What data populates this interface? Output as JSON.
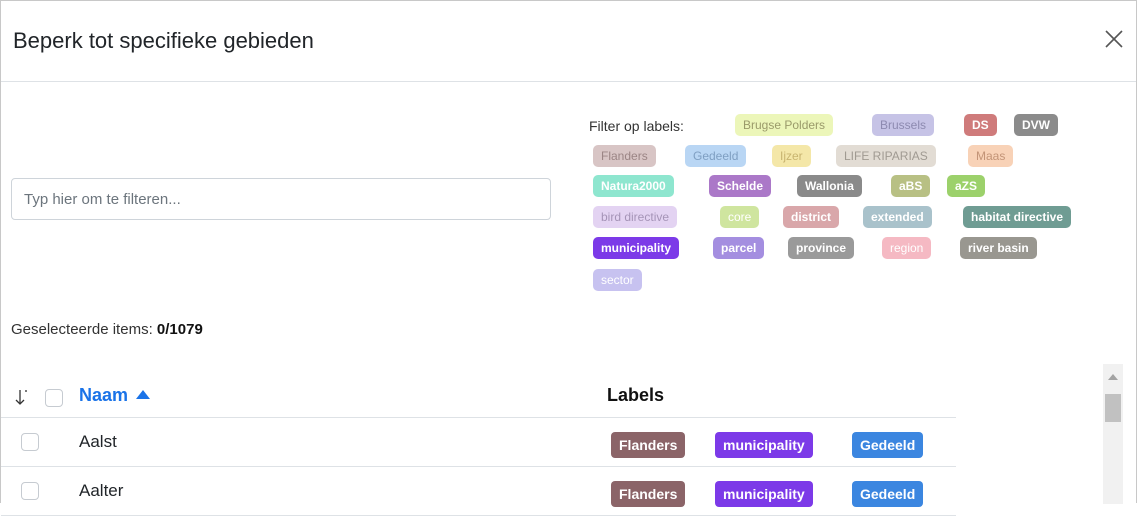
{
  "dialog": {
    "title": "Beperk tot specifieke gebieden"
  },
  "search": {
    "placeholder": "Typ hier om te filteren...",
    "value": ""
  },
  "filter": {
    "prefix": "Filter op labels:",
    "chips": [
      {
        "label": "Brugse Polders",
        "bg": "#ecf6b9",
        "fg": "#9a9a6a",
        "bold": false
      },
      {
        "label": "Brussels",
        "bg": "#c6c3e6",
        "fg": "#8d8ab0",
        "bold": false
      },
      {
        "label": "DS",
        "bg": "#cf7b7b",
        "fg": "#ffffff",
        "bold": true
      },
      {
        "label": "DVW",
        "bg": "#8b8b8b",
        "fg": "#ffffff",
        "bold": true
      },
      {
        "label": "Flanders",
        "bg": "#d8c5c5",
        "fg": "#9b8585",
        "bold": false
      },
      {
        "label": "Gedeeld",
        "bg": "#b9d6f4",
        "fg": "#7f9fc2",
        "bold": false
      },
      {
        "label": "Ijzer",
        "bg": "#f4e7a8",
        "fg": "#c8b470",
        "bold": false
      },
      {
        "label": "LIFE RIPARIAS",
        "bg": "#e2dcd4",
        "fg": "#a09a92",
        "bold": false
      },
      {
        "label": "Maas",
        "bg": "#f8d2b7",
        "fg": "#c39477",
        "bold": false
      },
      {
        "label": "Natura2000",
        "bg": "#8ee6cf",
        "fg": "#ffffff",
        "bold": true
      },
      {
        "label": "Schelde",
        "bg": "#ab78c8",
        "fg": "#ffffff",
        "bold": true
      },
      {
        "label": "Wallonia",
        "bg": "#8a8a8a",
        "fg": "#ffffff",
        "bold": true
      },
      {
        "label": "aBS",
        "bg": "#b8c084",
        "fg": "#ffffff",
        "bold": true
      },
      {
        "label": "aZS",
        "bg": "#9cd16b",
        "fg": "#ffffff",
        "bold": true
      },
      {
        "label": "bird directive",
        "bg": "#e3d3f2",
        "fg": "#a594b7",
        "bold": false
      },
      {
        "label": "core",
        "bg": "#cfe59f",
        "fg": "#ffffff",
        "bold": false
      },
      {
        "label": "district",
        "bg": "#d9a7aa",
        "fg": "#ffffff",
        "bold": true
      },
      {
        "label": "extended",
        "bg": "#a9c2cb",
        "fg": "#ffffff",
        "bold": true
      },
      {
        "label": "habitat directive",
        "bg": "#6f9c93",
        "fg": "#ffffff",
        "bold": true
      },
      {
        "label": "municipality",
        "bg": "#7c3ae8",
        "fg": "#ffffff",
        "bold": true
      },
      {
        "label": "parcel",
        "bg": "#a48ee0",
        "fg": "#ffffff",
        "bold": true
      },
      {
        "label": "province",
        "bg": "#9a9a9a",
        "fg": "#ffffff",
        "bold": true
      },
      {
        "label": "region",
        "bg": "#f5b9c3",
        "fg": "#ffffff",
        "bold": false
      },
      {
        "label": "river basin",
        "bg": "#999790",
        "fg": "#ffffff",
        "bold": true
      },
      {
        "label": "sector",
        "bg": "#c7c2f0",
        "fg": "#ffffff",
        "bold": false
      }
    ]
  },
  "selection": {
    "prefix": "Geselecteerde items: ",
    "count": "0/1079"
  },
  "table": {
    "columns": {
      "name": "Naam",
      "labels": "Labels"
    },
    "rows": [
      {
        "name": "Aalst",
        "tags": [
          {
            "label": "Flanders",
            "color": "#8b6468"
          },
          {
            "label": "municipality",
            "color": "#7c3ae8"
          },
          {
            "label": "Gedeeld",
            "color": "#3b86e0"
          }
        ]
      },
      {
        "name": "Aalter",
        "tags": [
          {
            "label": "Flanders",
            "color": "#8b6468"
          },
          {
            "label": "municipality",
            "color": "#7c3ae8"
          },
          {
            "label": "Gedeeld",
            "color": "#3b86e0"
          }
        ]
      }
    ]
  }
}
